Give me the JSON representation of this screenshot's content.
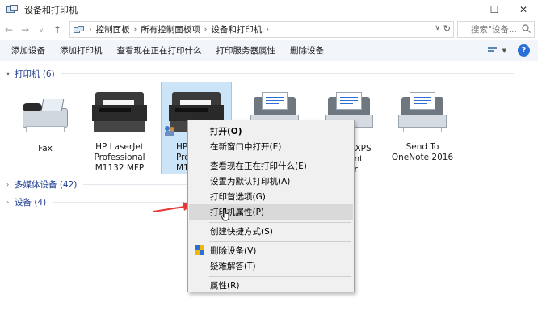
{
  "window": {
    "title": "设备和打印机",
    "minimize": "—",
    "maximize": "☐",
    "close": "✕"
  },
  "nav": {
    "back": "←",
    "forward": "→",
    "recent": "∨",
    "up": "↑"
  },
  "address": {
    "crumbs": [
      "控制面板",
      "所有控制面板项",
      "设备和打印机"
    ],
    "separator": "›",
    "dropdown": "∨",
    "refresh": "↻"
  },
  "search": {
    "placeholder": "搜索\"设备...",
    "icon": "search-icon"
  },
  "commands": [
    "添加设备",
    "添加打印机",
    "查看现在正在打印什么",
    "打印服务器属性",
    "删除设备"
  ],
  "help_label": "?",
  "groups": {
    "printers": "打印机 (6)",
    "multimedia": "多媒体设备 (42)",
    "devices": "设备 (4)"
  },
  "devices": [
    {
      "name": "fax",
      "label": "Fax"
    },
    {
      "name": "hp-laserjet-1",
      "label": "HP LaserJet Professional M1132 MFP"
    },
    {
      "name": "hp-laserjet-2",
      "label_visible": "HP\nProf\nM11"
    },
    {
      "name": "printer-4",
      "label_visible": ""
    },
    {
      "name": "ms-xps",
      "label_visible": "t XPS\nent\ner"
    },
    {
      "name": "onenote",
      "label": "Send To OneNote 2016"
    }
  ],
  "hp2_label_parts": [
    "HP",
    "Prof",
    "M11"
  ],
  "xps_label_parts": [
    "t XPS",
    "ent",
    "er"
  ],
  "context_menu": {
    "open": "打开(O)",
    "open_new_window": "在新窗口中打开(E)",
    "see_printing": "查看现在正在打印什么(E)",
    "set_default": "设置为默认打印机(A)",
    "print_prefs": "打印首选项(G)",
    "printer_props": "打印机属性(P)",
    "create_shortcut": "创建快捷方式(S)",
    "remove_device": "删除设备(V)",
    "troubleshoot": "疑难解答(T)",
    "properties": "属性(R)"
  },
  "colors": {
    "group_header": "#1e3d8f",
    "selection": "#cce4f7",
    "arrow": "#e53935",
    "command_bar": "#f2f6fb"
  }
}
